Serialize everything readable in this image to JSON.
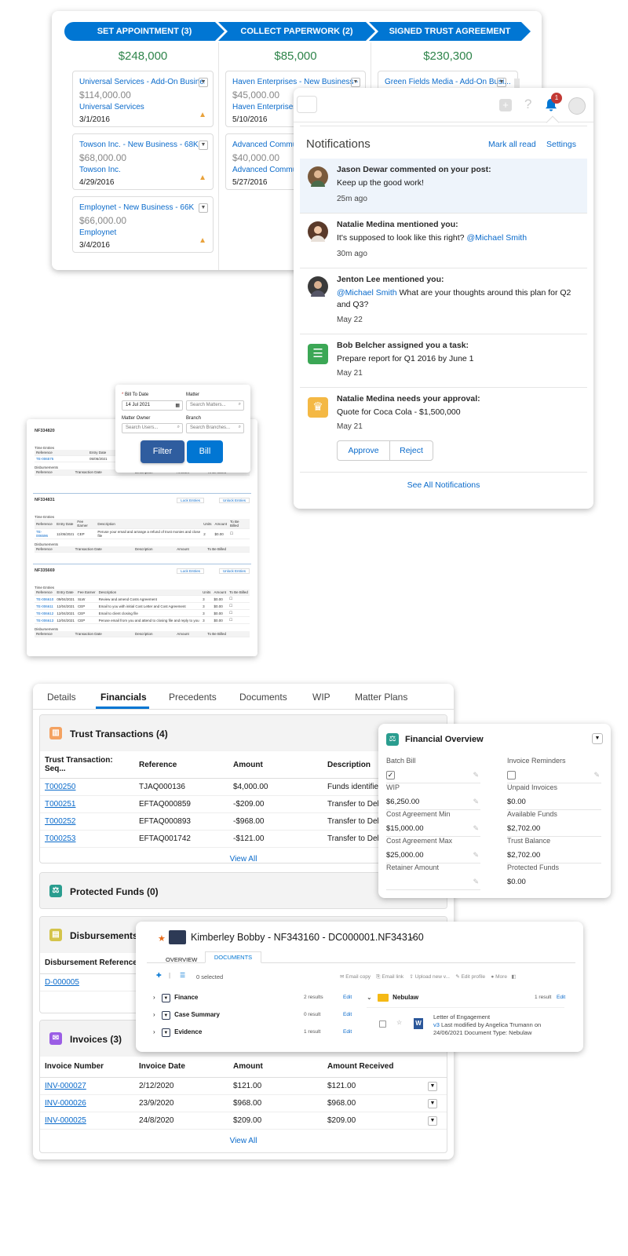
{
  "kanban": {
    "stages": [
      {
        "label": "SET APPOINTMENT  (3)",
        "amount": "$248,000",
        "cards": [
          {
            "title": "Universal Services - Add-On Business ...",
            "amount": "$114,000.00",
            "account": "Universal Services",
            "date": "3/1/2016"
          },
          {
            "title": "Towson Inc. - New Business - 68K",
            "amount": "$68,000.00",
            "account": "Towson Inc.",
            "date": "4/29/2016"
          },
          {
            "title": "Employnet - New Business - 66K",
            "amount": "$66,000.00",
            "account": "Employnet",
            "date": "3/4/2016"
          }
        ]
      },
      {
        "label": "COLLECT PAPERWORK  (2)",
        "amount": "$85,000",
        "cards": [
          {
            "title": "Haven Enterprises - New Business - 4...",
            "amount": "$45,000.00",
            "account": "Haven Enterprises",
            "date": "5/10/2016"
          },
          {
            "title": "Advanced Communic",
            "amount": "$40,000.00",
            "account": "Advanced Communic",
            "date": "5/27/2016"
          }
        ]
      },
      {
        "label": "SIGNED TRUST AGREEMENT",
        "amount": "$230,300",
        "cards": [
          {
            "title": "Green Fields Media - Add-On Busi...",
            "amount": "",
            "account": "",
            "date": ""
          }
        ]
      }
    ]
  },
  "header": {
    "notification_count": "1"
  },
  "notifications": {
    "title": "Notifications",
    "mark_all_read": "Mark all read",
    "settings": "Settings",
    "items": [
      {
        "who": "Jason Dewar commented on your post:",
        "msg": "Keep up the good work!",
        "mention": "",
        "time": "25m ago"
      },
      {
        "who": "Natalie Medina mentioned you:",
        "msg": "It's supposed to look like this right?",
        "mention": "@Michael Smith",
        "time": "30m ago"
      },
      {
        "who": "Jenton Lee mentioned you:",
        "mention": "@Michael Smith",
        "msg": " What are your thoughts around this plan for Q2 and Q3?",
        "time": "May 22"
      },
      {
        "who": "Bob Belcher assigned you a task:",
        "msg": "Prepare report for Q1 2016 by June 1",
        "mention": "",
        "time": "May 21"
      },
      {
        "who": "Natalie Medina needs your approval:",
        "msg": "Quote for Coca Cola - $1,500,000",
        "mention": "",
        "time": "May 21"
      }
    ],
    "approve": "Approve",
    "reject": "Reject",
    "see_all": "See All Notifications"
  },
  "filter": {
    "bill_to_date_label": "Bill To Date",
    "bill_to_date_value": "14 Jul 2021",
    "matter_label": "Matter",
    "matter_placeholder": "Search Matters...",
    "matter_owner_label": "Matter Owner",
    "matter_owner_placeholder": "Search Users...",
    "branch_label": "Branch",
    "branch_placeholder": "Search Branches...",
    "filter_btn": "Filter",
    "bill_btn": "Bill"
  },
  "billing": {
    "lock": "Lock Entries",
    "unlock": "Unlock Entries",
    "time_entries": "Time Entries",
    "disbursements": "Disbursements",
    "te_headers": [
      "Reference",
      "Entry Date",
      "Fee Earner",
      "Description",
      "Units",
      "Amount",
      "To Be Billed"
    ],
    "d_headers": [
      "Reference",
      "Transaction Date",
      "Description",
      "Amount",
      "To Be Billed"
    ],
    "matters": [
      {
        "id": "NF334820",
        "rows": [
          [
            "TE-006575",
            "05/06/2021",
            "SLW",
            "Telep",
            "",
            "",
            ""
          ]
        ]
      },
      {
        "id": "NF334831",
        "rows": [
          [
            "TE-006596",
            "11/05/2021",
            "CEP",
            "Peruse your email and arrange a refund of trust monies and close file",
            "2",
            "$0.00",
            ""
          ]
        ]
      },
      {
        "id": "NF335669",
        "rows": [
          [
            "TE-006610",
            "09/04/2021",
            "SLW",
            "Review and amend Costs Agreement",
            "3",
            "$0.00",
            ""
          ],
          [
            "TE-006611",
            "12/04/2021",
            "CEP",
            "Email to you with initial Cost Letter and Cost Agreement",
            "3",
            "$0.00",
            ""
          ],
          [
            "TE-006612",
            "12/04/2021",
            "CEP",
            "Email to client closing file",
            "3",
            "$0.00",
            ""
          ],
          [
            "TE-006613",
            "12/04/2021",
            "CEP",
            "Peruse email from you and attend to closing file and reply to you",
            "3",
            "$0.00",
            ""
          ]
        ]
      }
    ]
  },
  "matter": {
    "tabs": [
      "Details",
      "Financials",
      "Precedents",
      "Documents",
      "WIP",
      "Matter Plans"
    ],
    "trust": {
      "title": "Trust Transactions (4)",
      "headers": [
        "Trust Transaction: Seq...",
        "Reference",
        "Amount",
        "Description"
      ],
      "rows": [
        [
          "T000250",
          "TJAQ000136",
          "$4,000.00",
          "Funds identified"
        ],
        [
          "T000251",
          "EFTAQ000859",
          "-$209.00",
          "Transfer to Deb"
        ],
        [
          "T000252",
          "EFTAQ000893",
          "-$968.00",
          "Transfer to Deb"
        ],
        [
          "T000253",
          "EFTAQ001742",
          "-$121.00",
          "Transfer to Deb"
        ]
      ],
      "view_all": "View All"
    },
    "protected": {
      "title": "Protected Funds (0)"
    },
    "disb": {
      "title": "Disbursements",
      "header": "Disbursement Reference",
      "row": "D-000005"
    },
    "invoices": {
      "title": "Invoices (3)",
      "headers": [
        "Invoice Number",
        "Invoice Date",
        "Amount",
        "Amount Received"
      ],
      "rows": [
        [
          "INV-000027",
          "2/12/2020",
          "$121.00",
          "$121.00"
        ],
        [
          "INV-000026",
          "23/9/2020",
          "$968.00",
          "$968.00"
        ],
        [
          "INV-000025",
          "24/8/2020",
          "$209.00",
          "$209.00"
        ]
      ],
      "view_all": "View All"
    }
  },
  "financial": {
    "title": "Financial Overview",
    "fields": [
      {
        "label": "Batch Bill",
        "value": "checked"
      },
      {
        "label": "Invoice Reminders",
        "value": "unchecked"
      },
      {
        "label": "WIP",
        "value": "$6,250.00"
      },
      {
        "label": "Unpaid Invoices",
        "value": "$0.00"
      },
      {
        "label": "Cost Agreement Min",
        "value": "$15,000.00"
      },
      {
        "label": "Available Funds",
        "value": "$2,702.00"
      },
      {
        "label": "Cost Agreement Max",
        "value": "$25,000.00"
      },
      {
        "label": "Trust Balance",
        "value": "$2,702.00"
      },
      {
        "label": "Retainer Amount",
        "value": ""
      },
      {
        "label": "Protected Funds",
        "value": "$0.00"
      }
    ]
  },
  "docs": {
    "title": "Kimberley Bobby - NF343160 - DC000001.NF343160",
    "tabs": [
      "OVERVIEW",
      "DOCUMENTS"
    ],
    "selected": "0 selected",
    "actions": [
      "Email copy",
      "Email link",
      "Upload new v...",
      "Edit profile",
      "More"
    ],
    "folders": [
      {
        "name": "Finance",
        "count": "2 results",
        "edit": "Edit"
      },
      {
        "name": "Case Summary",
        "count": "0 result",
        "edit": "Edit"
      },
      {
        "name": "Evidence",
        "count": "1 result",
        "edit": "Edit"
      }
    ],
    "right_folder": {
      "name": "Nebulaw",
      "count": "1 result",
      "edit": "Edit"
    },
    "doc": {
      "name": "Letter of Engagement",
      "version": "v3",
      "modified": " Last modified by Angelica Trumann on",
      "date_type": "24/06/2021   Document Type: Nebulaw"
    }
  },
  "colors": {
    "brand": "#0176d3",
    "green": "#2e844a",
    "link": "#0b6bcb"
  }
}
